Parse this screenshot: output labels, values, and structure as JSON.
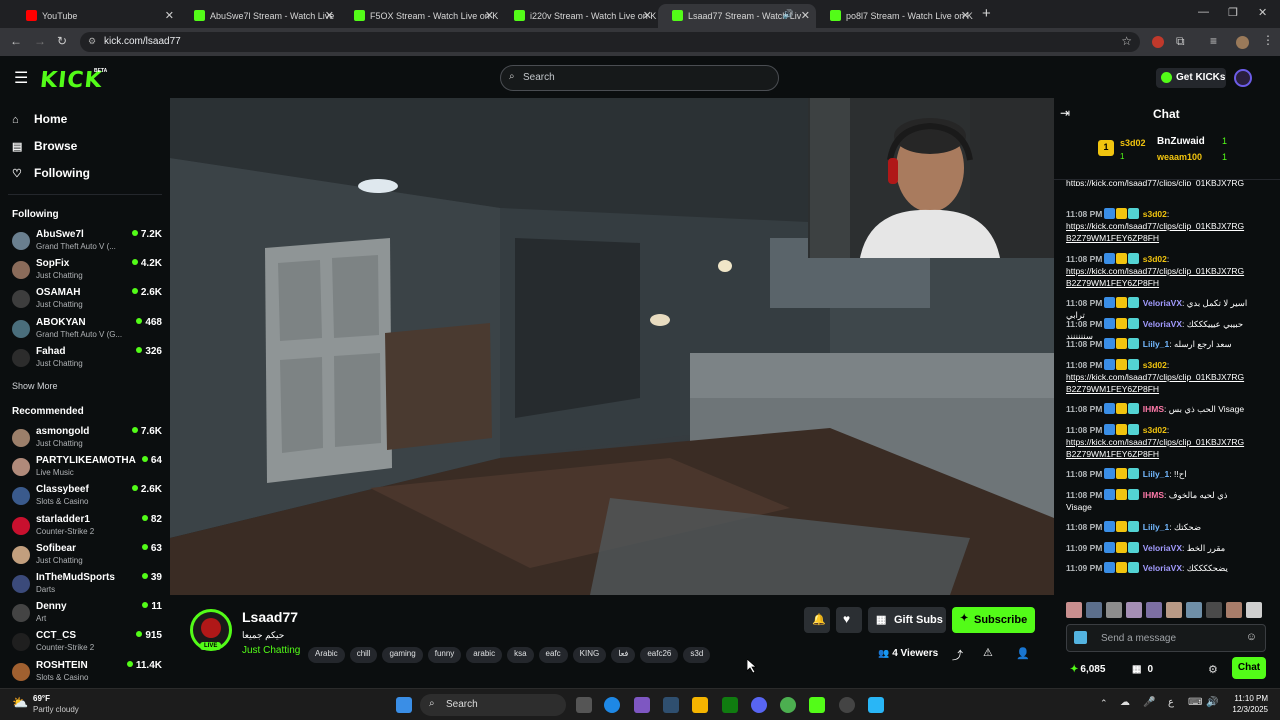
{
  "browser": {
    "tabs": [
      {
        "label": "YouTube",
        "color": "#ff0000"
      },
      {
        "label": "AbuSwe7l Stream - Watch Live",
        "color": "#53fc18"
      },
      {
        "label": "F5OX Stream - Watch Live on K",
        "color": "#53fc18"
      },
      {
        "label": "i220v Stream - Watch Live on K",
        "color": "#53fc18"
      },
      {
        "label": "Lsaad77 Stream - Watch Liv",
        "color": "#53fc18"
      },
      {
        "label": "po8l7 Stream - Watch Live on K",
        "color": "#53fc18"
      }
    ],
    "new_tab": "+",
    "url": "kick.com/lsaad77"
  },
  "header": {
    "logo": "KICK",
    "beta": "BETA",
    "search_placeholder": "Search",
    "get_kicks": "Get KICKs"
  },
  "sidebar": {
    "nav": [
      {
        "label": "Home",
        "icon": "home-icon"
      },
      {
        "label": "Browse",
        "icon": "browse-icon"
      },
      {
        "label": "Following",
        "icon": "heart-icon"
      }
    ],
    "following_title": "Following",
    "following": [
      {
        "name": "AbuSwe7l",
        "category": "Grand Theft Auto V (...",
        "viewers": "7.2K",
        "color": "#6a7f8f"
      },
      {
        "name": "SopFix",
        "category": "Just Chatting",
        "viewers": "4.2K",
        "color": "#8a6b5a"
      },
      {
        "name": "OSAMAH",
        "category": "Just Chatting",
        "viewers": "2.6K",
        "color": "#3d3d3d"
      },
      {
        "name": "ABOKYAN",
        "category": "Grand Theft Auto V (G...",
        "viewers": "468",
        "color": "#4a6e7c"
      },
      {
        "name": "Fahad",
        "category": "Just Chatting",
        "viewers": "326",
        "color": "#2c2c2c"
      }
    ],
    "show_more": "Show More",
    "recommended_title": "Recommended",
    "recommended": [
      {
        "name": "asmongold",
        "category": "Just Chatting",
        "viewers": "7.6K",
        "color": "#9c7f6a"
      },
      {
        "name": "PARTYLIKEAMOTHA",
        "category": "Live Music",
        "viewers": "64",
        "color": "#b08a7a"
      },
      {
        "name": "Classybeef",
        "category": "Slots & Casino",
        "viewers": "2.6K",
        "color": "#3a5a8c"
      },
      {
        "name": "starladder1",
        "category": "Counter-Strike 2",
        "viewers": "82",
        "color": "#c8102e"
      },
      {
        "name": "Sofibear",
        "category": "Just Chatting",
        "viewers": "63",
        "color": "#c29f7e"
      },
      {
        "name": "InTheMudSports",
        "category": "Darts",
        "viewers": "39",
        "color": "#3b4a7a"
      },
      {
        "name": "Denny",
        "category": "Art",
        "viewers": "11",
        "color": "#444444"
      },
      {
        "name": "CCT_CS",
        "category": "Counter-Strike 2",
        "viewers": "915",
        "color": "#1f1f1f"
      },
      {
        "name": "ROSHTEIN",
        "category": "Slots & Casino",
        "viewers": "11.4K",
        "color": "#a06030"
      }
    ]
  },
  "stream": {
    "streamer": "Lsaad77",
    "title": "حيكم جميعا",
    "category": "Just Chatting",
    "live_badge": "LIVE",
    "tags": [
      "Arabic",
      "chill",
      "gaming",
      "funny",
      "arabic",
      "ksa",
      "eafc",
      "KING",
      "فعا",
      "eafc26",
      "s3d"
    ],
    "gift_subs": "Gift Subs",
    "subscribe": "Subscribe",
    "viewers": "4 Viewers"
  },
  "chat": {
    "title": "Chat",
    "leaderboard": [
      {
        "rank": "1",
        "name": "s3d02",
        "count": "1"
      },
      {
        "rank": "",
        "name": "BnZuwaid",
        "count": "1"
      },
      {
        "rank": "",
        "name": "weaam100",
        "count": "1"
      }
    ],
    "top_link_fragment": "https://kick.com/lsaad77/clips/clip_01KBJX7RG",
    "messages": [
      {
        "time": "11:08 PM",
        "user": "s3d02",
        "color": "#f1c40f",
        "text": "https://kick.com/lsaad77/clips/clip_01KBJX7RG",
        "text2": "B2Z79WM1FEY6ZP8FH",
        "link": true
      },
      {
        "time": "11:08 PM",
        "user": "s3d02",
        "color": "#f1c40f",
        "text": "https://kick.com/lsaad77/clips/clip_01KBJX7RG",
        "text2": "B2Z79WM1FEY6ZP8FH",
        "link": true
      },
      {
        "time": "11:08 PM",
        "user": "VeloriaVX",
        "color": "#a29bfe",
        "text": "اسير لا تكمل بدي ترابي",
        "text2": "",
        "link": false
      },
      {
        "time": "11:08 PM",
        "user": "VeloriaVX",
        "color": "#a29bfe",
        "text": "حبيبي عيييكككك سنننننند",
        "text2": "",
        "link": false
      },
      {
        "time": "11:08 PM",
        "user": "Liily_1",
        "color": "#74b9ff",
        "text": "سعد ارجع ارسله",
        "text2": "",
        "link": false
      },
      {
        "time": "11:08 PM",
        "user": "s3d02",
        "color": "#f1c40f",
        "text": "https://kick.com/lsaad77/clips/clip_01KBJX7RG",
        "text2": "B2Z79WM1FEY6ZP8FH",
        "link": true
      },
      {
        "time": "11:08 PM",
        "user": "IHMS",
        "color": "#fd79a8",
        "text": "الحب ذي بس Visage",
        "text2": "",
        "link": false
      },
      {
        "time": "11:08 PM",
        "user": "s3d02",
        "color": "#f1c40f",
        "text": "https://kick.com/lsaad77/clips/clip_01KBJX7RG",
        "text2": "B2Z79WM1FEY6ZP8FH",
        "link": true
      },
      {
        "time": "11:08 PM",
        "user": "Liily_1",
        "color": "#74b9ff",
        "text": "!!اح",
        "text2": "",
        "link": false
      },
      {
        "time": "11:08 PM",
        "user": "IHMS",
        "color": "#fd79a8",
        "text": "ذي لحيه مالخوف",
        "text2": "Visage",
        "link": false
      },
      {
        "time": "11:08 PM",
        "user": "Liily_1",
        "color": "#74b9ff",
        "text": "ضحكتك",
        "text2": "",
        "link": false
      },
      {
        "time": "11:09 PM",
        "user": "VeloriaVX",
        "color": "#a29bfe",
        "text": "مقرر الخط",
        "text2": "",
        "link": false
      },
      {
        "time": "11:09 PM",
        "user": "VeloriaVX",
        "color": "#a29bfe",
        "text": "يضحككككك",
        "text2": "",
        "link": false
      }
    ],
    "input_placeholder": "Send a message",
    "points": "6,085",
    "gifts": "0",
    "chat_button": "Chat"
  },
  "taskbar": {
    "weather_temp": "69°F",
    "weather_desc": "Partly cloudy",
    "search": "Search",
    "time": "11:10 PM",
    "date": "12/3/2025"
  },
  "colors": {
    "accent": "#53fc18",
    "background": "#0b0e0f"
  }
}
